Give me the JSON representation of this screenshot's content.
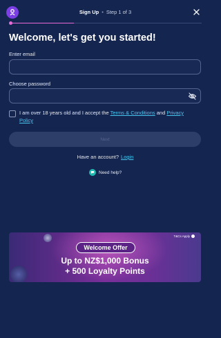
{
  "header": {
    "title": "Sign Up",
    "separator": "•",
    "step": "Step 1 of 3",
    "progress": 0.333
  },
  "form": {
    "title": "Welcome, let's get you started!",
    "email_label": "Enter email",
    "email_value": "",
    "password_label": "Choose password",
    "password_value": "",
    "terms_prefix": "I am over 18 years old and I accept the",
    "terms_link": "Terms & Conditions",
    "terms_and": "and",
    "privacy_link": "Privacy Policy",
    "next_label": "Next",
    "have_account": "Have an account?",
    "login_link": "Login",
    "help_label": "Need help?"
  },
  "banner": {
    "tc_label": "T&Cs Apply",
    "offer_label": "Welcome Offer",
    "line1": "Up to NZ$1,000 Bonus",
    "line2": "+ 500 Loyalty Points"
  },
  "colors": {
    "background": "#142550",
    "accent_link": "#47c6f0",
    "progress": "#e86bd8",
    "logo": "#7b3fe4",
    "help_icon": "#1fb9b0"
  },
  "icons": {
    "logo": "casino-logo-icon",
    "close": "close-icon",
    "password_toggle": "eye-off-icon",
    "help": "chat-icon"
  }
}
